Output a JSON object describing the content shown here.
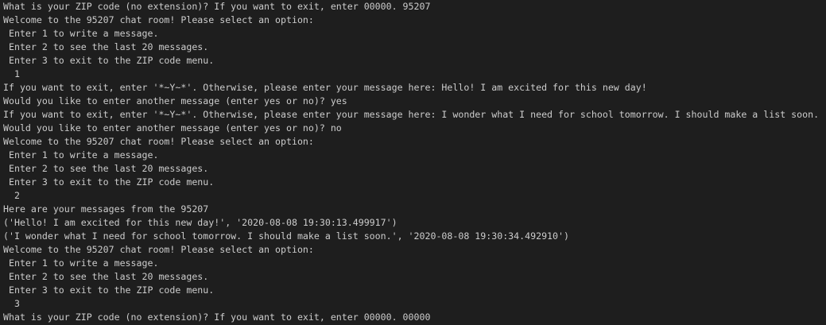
{
  "terminal": {
    "lines": [
      "What is your ZIP code (no extension)? If you want to exit, enter 00000. 95207",
      "Welcome to the 95207 chat room! Please select an option:",
      " Enter 1 to write a message.",
      " Enter 2 to see the last 20 messages.",
      " Enter 3 to exit to the ZIP code menu.",
      "  1",
      "If you want to exit, enter '*~Y~*'. Otherwise, please enter your message here: Hello! I am excited for this new day!",
      "Would you like to enter another message (enter yes or no)? yes",
      "If you want to exit, enter '*~Y~*'. Otherwise, please enter your message here: I wonder what I need for school tomorrow. I should make a list soon.",
      "Would you like to enter another message (enter yes or no)? no",
      "Welcome to the 95207 chat room! Please select an option:",
      " Enter 1 to write a message.",
      " Enter 2 to see the last 20 messages.",
      " Enter 3 to exit to the ZIP code menu.",
      "  2",
      "Here are your messages from the 95207",
      "('Hello! I am excited for this new day!', '2020-08-08 19:30:13.499917')",
      "('I wonder what I need for school tomorrow. I should make a list soon.', '2020-08-08 19:30:34.492910')",
      "Welcome to the 95207 chat room! Please select an option:",
      " Enter 1 to write a message.",
      " Enter 2 to see the last 20 messages.",
      " Enter 3 to exit to the ZIP code menu.",
      "  3",
      "What is your ZIP code (no extension)? If you want to exit, enter 00000. 00000"
    ]
  }
}
